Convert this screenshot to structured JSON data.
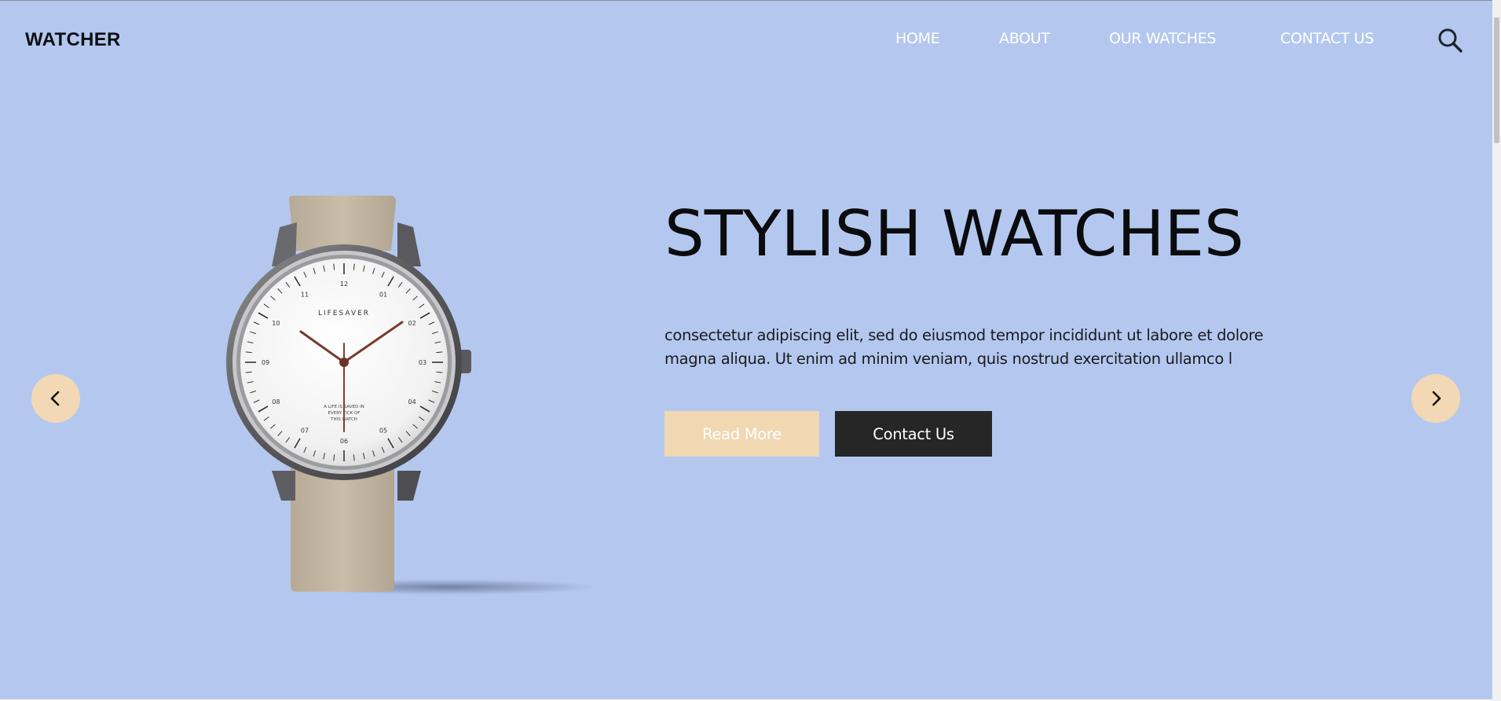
{
  "brand": {
    "logo_text": "WATCHER"
  },
  "nav": {
    "items": [
      {
        "label": "HOME"
      },
      {
        "label": "ABOUT"
      },
      {
        "label": "OUR WATCHES"
      },
      {
        "label": "CONTACT US"
      }
    ],
    "search_icon": "search-icon"
  },
  "hero": {
    "title": "STYLISH WATCHES",
    "description": "consectetur adipiscing elit, sed do eiusmod tempor incididunt ut labore et dolore magna aliqua. Ut enim ad minim veniam, quis nostrud exercitation ullamco l",
    "read_more_label": "Read More",
    "contact_label": "Contact Us",
    "watch": {
      "brand": "LIFESAVER",
      "tagline_lines": [
        "A LIFE IS SAVED IN",
        "EVERY TICK OF",
        "THIS WATCH"
      ],
      "hours": [
        "12",
        "01",
        "02",
        "03",
        "04",
        "05",
        "06",
        "07",
        "08",
        "09",
        "10",
        "11"
      ]
    }
  },
  "carousel": {
    "prev_icon": "chevron-left-icon",
    "next_icon": "chevron-right-icon"
  },
  "colors": {
    "background": "#b4c8ef",
    "accent": "#f2d7b3",
    "dark": "#262626",
    "text": "#0b0b0d"
  }
}
